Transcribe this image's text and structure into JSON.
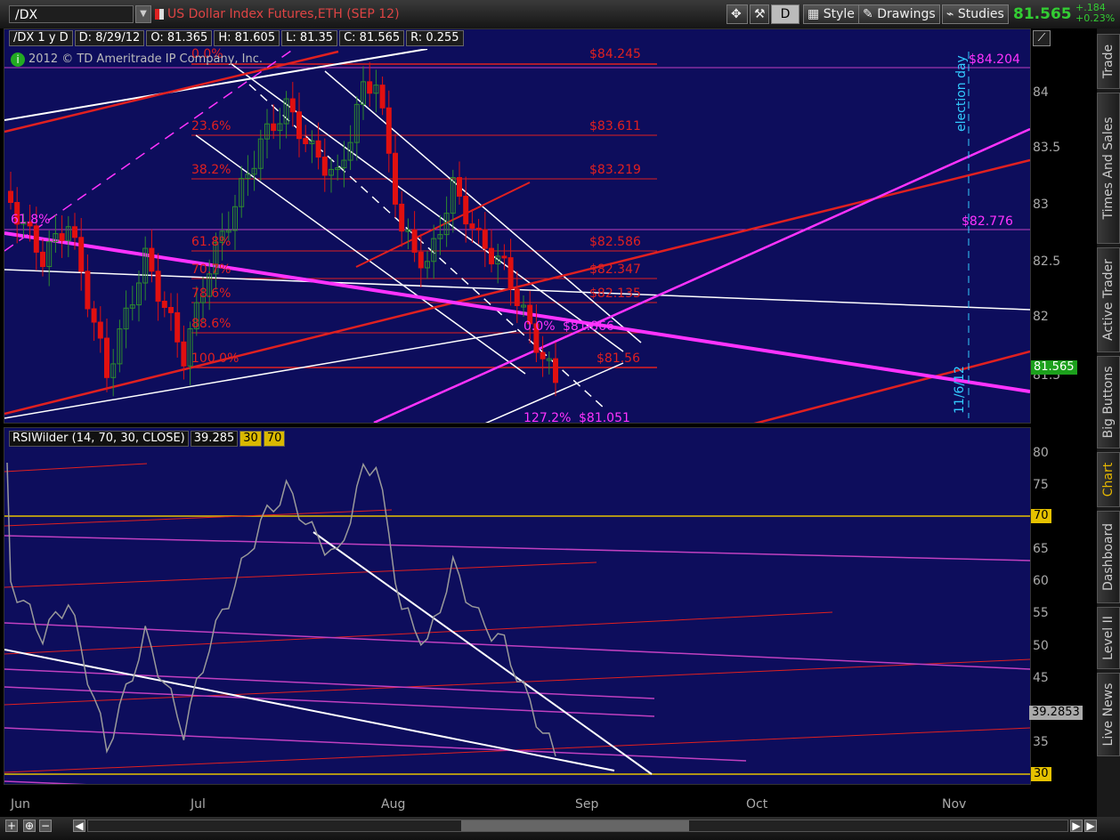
{
  "header": {
    "symbol": "/DX",
    "description": "US Dollar Index Futures,ETH (SEP 12)",
    "style_label": "Style",
    "drawings_label": "Drawings",
    "studies_label": "Studies",
    "d_label": "D",
    "last_price": "81.565",
    "change": "+.184",
    "change_pct": "+0.23%"
  },
  "chart_info": {
    "symbol_period": "/DX 1 y D",
    "date": "D: 8/29/12",
    "open": "O: 81.365",
    "high": "H: 81.605",
    "low": "L: 81.35",
    "close": "C: 81.565",
    "range": "R: 0.255",
    "copyright": "2012 © TD Ameritrade IP Company, Inc."
  },
  "price_axis": {
    "ticks": [
      "84",
      "83.5",
      "83",
      "82.5",
      "82",
      "81.5"
    ],
    "last_badge": "81.565"
  },
  "fib_labels": [
    {
      "pct": "0.0%",
      "price": "$84.245"
    },
    {
      "pct": "23.6%",
      "price": "$83.611"
    },
    {
      "pct": "38.2%",
      "price": "$83.219"
    },
    {
      "pct": "61.8%",
      "price": "$82.586"
    },
    {
      "pct": "70.7%",
      "price": "$82.347"
    },
    {
      "pct": "78.6%",
      "price": "$82.135"
    },
    {
      "pct": "88.6%",
      "price": "$81.866"
    },
    {
      "pct": "100.0%",
      "price": "$81.56"
    }
  ],
  "annotations": {
    "top_right": "$84.204",
    "mid_right": "$82.776",
    "left_618": "61.8%",
    "zero_pct_small": "0.0%",
    "price_8186": "$81.866",
    "ext_pct": "127.2%",
    "ext_price": "$81.051",
    "election": "election day",
    "election_date": "11/6/12"
  },
  "rsi": {
    "name": "RSIWilder (14, 70, 30, CLOSE)",
    "value": "39.285",
    "ob": "30",
    "os": "70",
    "ticks": [
      "80",
      "75",
      "65",
      "60",
      "55",
      "50",
      "45",
      "35"
    ],
    "badge_70": "70",
    "badge_30": "30",
    "badge_value": "39.2853"
  },
  "x_axis": [
    "Jun",
    "Jul",
    "Aug",
    "Sep",
    "Oct",
    "Nov"
  ],
  "side_tabs": [
    "Trade",
    "Times And Sales",
    "Active Trader",
    "Big Buttons",
    "Chart",
    "Dashboard",
    "Level II",
    "Live News"
  ],
  "colors": {
    "up": "#2e8b2e",
    "down": "#e01010",
    "background": "#0d0d5c",
    "magenta": "#ff33ff",
    "fib_red": "#e02020",
    "cyan": "#33ccff",
    "yellow": "#e6c200"
  },
  "chart_data": {
    "type": "line",
    "series": [
      {
        "name": "RSIWilder (14, 70, 30, CLOSE)",
        "last": 39.285
      }
    ],
    "ylim_price": [
      81.2,
      84.4
    ],
    "ylim_rsi": [
      30,
      80
    ]
  }
}
